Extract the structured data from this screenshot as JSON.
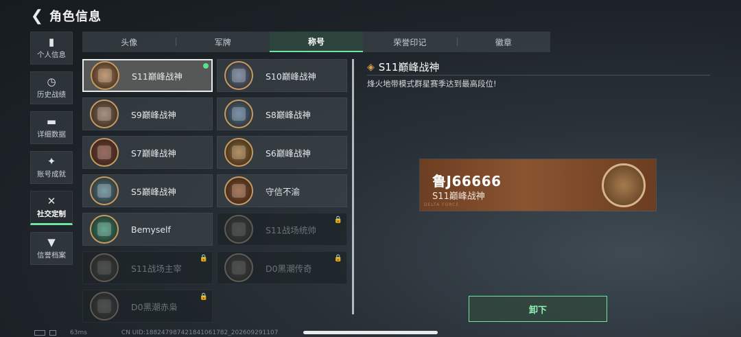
{
  "header": {
    "title": "角色信息"
  },
  "nav": [
    {
      "label": "个人信息",
      "icon": "bar-chart-icon",
      "glyph": "▮"
    },
    {
      "label": "历史战绩",
      "icon": "clock-icon",
      "glyph": "◷"
    },
    {
      "label": "详细数据",
      "icon": "folder-icon",
      "glyph": "▬"
    },
    {
      "label": "账号成就",
      "icon": "medal-icon",
      "glyph": "✦"
    },
    {
      "label": "社交定制",
      "icon": "tools-icon",
      "glyph": "✕",
      "active": true
    },
    {
      "label": "信誉档案",
      "icon": "shield-heart-icon",
      "glyph": "▼"
    }
  ],
  "tabs": [
    "头像",
    "军牌",
    "称号",
    "荣誉印记",
    "徽章"
  ],
  "active_tab": "称号",
  "titles": [
    {
      "name": "S11巅峰战神",
      "state": "selected",
      "color": "#b07a48"
    },
    {
      "name": "S10巅峰战神",
      "state": "owned",
      "color": "#5b6f8c"
    },
    {
      "name": "S9巅峰战神",
      "state": "owned",
      "color": "#8a6a52"
    },
    {
      "name": "S8巅峰战神",
      "state": "owned",
      "color": "#4d6f8e"
    },
    {
      "name": "S7巅峰战神",
      "state": "owned",
      "color": "#7a3a2a"
    },
    {
      "name": "S6巅峰战神",
      "state": "owned",
      "color": "#9a6a2a"
    },
    {
      "name": "S5巅峰战神",
      "state": "owned",
      "color": "#4e7d8c"
    },
    {
      "name": "守信不渝",
      "state": "owned",
      "color": "#8c4a22"
    },
    {
      "name": "Bemyself",
      "state": "owned",
      "color": "#2d8a6a"
    },
    {
      "name": "S11战场统帅",
      "state": "locked",
      "color": "#6b5a44"
    },
    {
      "name": "S11战场主宰",
      "state": "locked",
      "color": "#6b5a44"
    },
    {
      "name": "D0黑潮传奇",
      "state": "locked",
      "color": "#6b5a44"
    },
    {
      "name": "D0黑潮赤枭",
      "state": "locked",
      "color": "#6b5a44"
    }
  ],
  "detail": {
    "title": "S11巅峰战神",
    "description": "烽火地带模式群星赛季达到最高段位!"
  },
  "nameplate": {
    "player_name": "鲁J66666",
    "title": "S11巅峰战神",
    "brand": "DELTA FORCE"
  },
  "unequip_label": "卸下",
  "status": {
    "ping": "63ms",
    "uid": "CN UID:18824798742184106178​2_202609291107"
  },
  "colors": {
    "accent": "#6fe6a4",
    "nameplate": "#8a5431"
  }
}
